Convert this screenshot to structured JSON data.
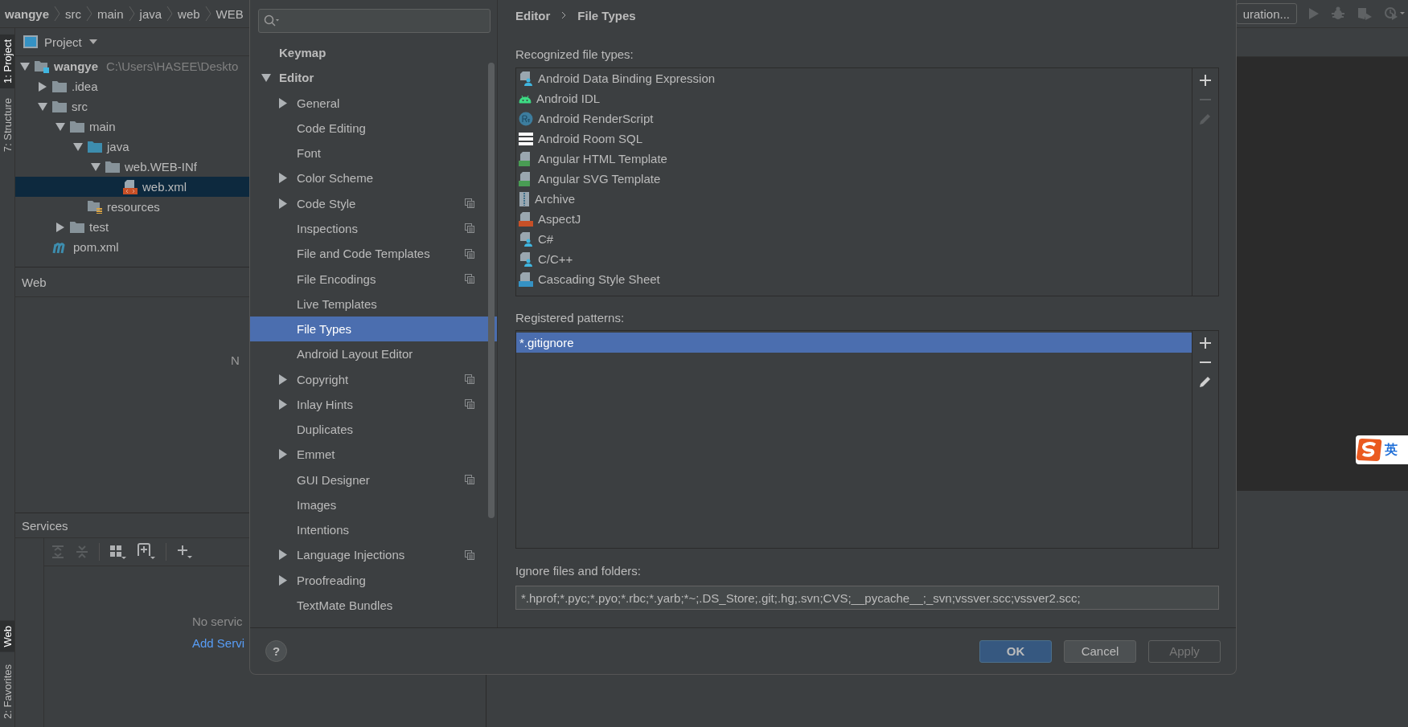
{
  "breadcrumb": [
    "wangye",
    "src",
    "main",
    "java",
    "web",
    "WEB"
  ],
  "run_config": {
    "label": "uration..."
  },
  "tool_strip_top": [
    {
      "label": "1: Project",
      "selected": true
    },
    {
      "label": "7: Structure",
      "selected": false
    }
  ],
  "tool_strip_bottom": [
    {
      "label": "Web",
      "selected": true
    },
    {
      "label": "2: Favorites",
      "selected": false
    }
  ],
  "project": {
    "title": "Project",
    "tree": [
      {
        "label": "wangye",
        "path": "C:\\Users\\HASEE\\Deskto",
        "kind": "module",
        "expanded": true,
        "selected": false,
        "children": [
          {
            "label": ".idea",
            "kind": "folder",
            "expanded": false,
            "selected": false
          },
          {
            "label": "src",
            "kind": "folder",
            "expanded": true,
            "selected": false,
            "children": [
              {
                "label": "main",
                "kind": "folder",
                "expanded": true,
                "selected": false,
                "children": [
                  {
                    "label": "java",
                    "kind": "source-folder",
                    "expanded": true,
                    "selected": false,
                    "children": [
                      {
                        "label": "web.WEB-INf",
                        "kind": "folder",
                        "expanded": true,
                        "selected": false,
                        "children": [
                          {
                            "label": "web.xml",
                            "kind": "xml",
                            "selected": true
                          }
                        ]
                      }
                    ]
                  },
                  {
                    "label": "resources",
                    "kind": "resources-folder",
                    "selected": false
                  }
                ]
              },
              {
                "label": "test",
                "kind": "folder",
                "expanded": false,
                "selected": false
              }
            ]
          },
          {
            "label": "pom.xml",
            "kind": "maven",
            "selected": false
          }
        ]
      }
    ]
  },
  "web_panel": {
    "title": "Web",
    "message": "N"
  },
  "services": {
    "title": "Services",
    "message": "No servic",
    "link": "Add Servi"
  },
  "ime": {
    "label": "英"
  },
  "dialog": {
    "settings_tree": [
      {
        "label": "Keymap",
        "selected": false
      },
      {
        "label": "Editor",
        "expanded": true,
        "selected": false,
        "children": [
          {
            "label": "General",
            "expanded": false,
            "project_level": false,
            "selected": false
          },
          {
            "label": "Code Editing",
            "project_level": false,
            "selected": false
          },
          {
            "label": "Font",
            "project_level": false,
            "selected": false
          },
          {
            "label": "Color Scheme",
            "expanded": false,
            "project_level": false,
            "selected": false
          },
          {
            "label": "Code Style",
            "expanded": false,
            "project_level": true,
            "selected": false
          },
          {
            "label": "Inspections",
            "project_level": true,
            "selected": false
          },
          {
            "label": "File and Code Templates",
            "project_level": true,
            "selected": false
          },
          {
            "label": "File Encodings",
            "project_level": true,
            "selected": false
          },
          {
            "label": "Live Templates",
            "project_level": false,
            "selected": false
          },
          {
            "label": "File Types",
            "project_level": false,
            "selected": true
          },
          {
            "label": "Android Layout Editor",
            "project_level": false,
            "selected": false
          },
          {
            "label": "Copyright",
            "expanded": false,
            "project_level": true,
            "selected": false
          },
          {
            "label": "Inlay Hints",
            "expanded": false,
            "project_level": true,
            "selected": false
          },
          {
            "label": "Duplicates",
            "project_level": false,
            "selected": false
          },
          {
            "label": "Emmet",
            "expanded": false,
            "project_level": false,
            "selected": false
          },
          {
            "label": "GUI Designer",
            "project_level": true,
            "selected": false
          },
          {
            "label": "Images",
            "project_level": false,
            "selected": false
          },
          {
            "label": "Intentions",
            "project_level": false,
            "selected": false
          },
          {
            "label": "Language Injections",
            "expanded": false,
            "project_level": true,
            "selected": false
          },
          {
            "label": "Proofreading",
            "expanded": false,
            "project_level": false,
            "selected": false
          },
          {
            "label": "TextMate Bundles",
            "project_level": false,
            "selected": false
          }
        ]
      }
    ],
    "breadcrumb": [
      "Editor",
      "File Types"
    ],
    "recognized": {
      "label": "Recognized file types:",
      "items": [
        {
          "label": "Android Data Binding Expression",
          "kind": "generic",
          "selected": false
        },
        {
          "label": "Android IDL",
          "kind": "android",
          "selected": false
        },
        {
          "label": "Android RenderScript",
          "kind": "renderscript",
          "selected": false
        },
        {
          "label": "Android Room SQL",
          "kind": "table",
          "selected": false
        },
        {
          "label": "Angular HTML Template",
          "kind": "angular",
          "selected": false
        },
        {
          "label": "Angular SVG Template",
          "kind": "angular",
          "selected": false
        },
        {
          "label": "Archive",
          "kind": "archive",
          "selected": false
        },
        {
          "label": "AspectJ",
          "kind": "aspectj",
          "selected": false
        },
        {
          "label": "C#",
          "kind": "generic",
          "selected": false
        },
        {
          "label": "C/C++",
          "kind": "generic",
          "selected": false
        },
        {
          "label": "Cascading Style Sheet",
          "kind": "css",
          "selected": false
        }
      ],
      "tools": [
        {
          "kind": "add",
          "disabled": false
        },
        {
          "kind": "remove",
          "disabled": true
        },
        {
          "kind": "edit",
          "disabled": true
        }
      ]
    },
    "patterns": {
      "label": "Registered patterns:",
      "items": [
        {
          "label": "*.gitignore",
          "selected": true
        }
      ],
      "tools": [
        {
          "kind": "add",
          "disabled": false
        },
        {
          "kind": "remove",
          "disabled": false
        },
        {
          "kind": "edit",
          "disabled": false
        }
      ]
    },
    "ignore": {
      "label": "Ignore files and folders:",
      "value": "*.hprof;*.pyc;*.pyo;*.rbc;*.yarb;*~;.DS_Store;.git;.hg;.svn;CVS;__pycache__;_svn;vssver.scc;vssver2.scc;"
    },
    "help": "?",
    "buttons": [
      {
        "label": "OK",
        "kind": "default",
        "disabled": false
      },
      {
        "label": "Cancel",
        "kind": "normal",
        "disabled": false
      },
      {
        "label": "Apply",
        "kind": "normal",
        "disabled": true
      }
    ]
  }
}
